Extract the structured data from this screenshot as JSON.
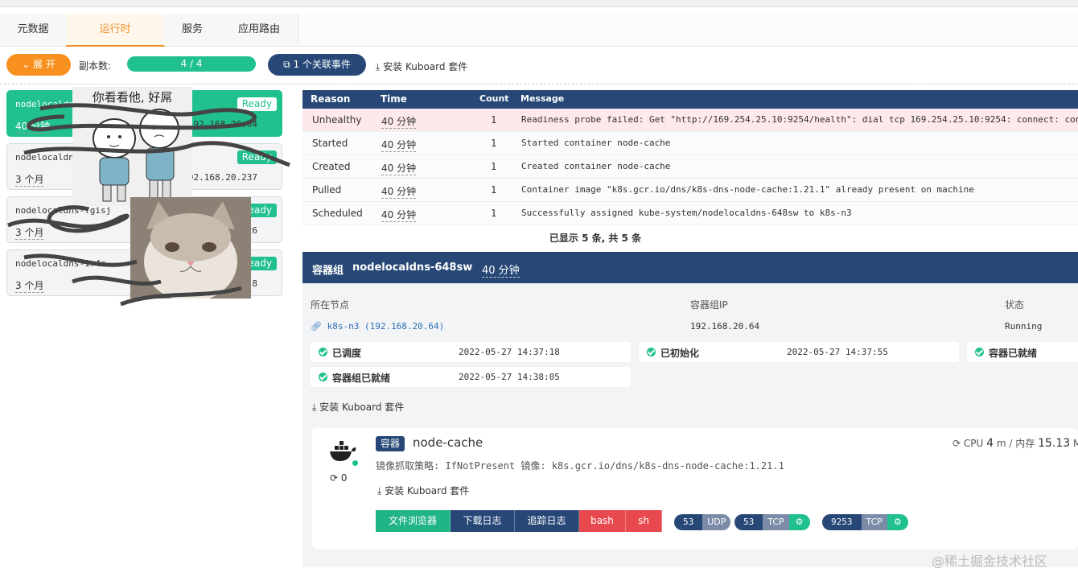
{
  "tabs": [
    "元数据",
    "运行时",
    "服务",
    "应用路由"
  ],
  "active_tab": "运行时",
  "toolbar": {
    "expand_label": "展 开",
    "replica_label": "副本数:",
    "replica_value": "4 / 4",
    "events_label": "1 个关联事件",
    "install_label": "安装 Kuboard 套件"
  },
  "pods": [
    {
      "name": "nodelocaldns-",
      "age": "40 分钟",
      "ip": "192.168.20.64",
      "status": "Ready",
      "active": true
    },
    {
      "name": "nodelocaldns-",
      "age": "3 个月",
      "ip": "192.168.20.237",
      "status": "Ready",
      "active": false
    },
    {
      "name": "nodelocaldns-fgisj",
      "age": "3 个月",
      "ip": "192.168.20.26",
      "status": "Ready",
      "active": false
    },
    {
      "name": "nodelocaldns-1r4c",
      "age": "3 个月",
      "ip": "192.168.20.8",
      "status": "Ready",
      "active": false
    }
  ],
  "events": {
    "headers": [
      "Reason",
      "Time",
      "Count",
      "Message"
    ],
    "rows": [
      {
        "reason": "Unhealthy",
        "time": "40 分钟",
        "count": "1",
        "message": "Readiness probe failed: Get \"http://169.254.25.10:9254/health\": dial tcp 169.254.25.10:9254: connect: con",
        "warn": true
      },
      {
        "reason": "Started",
        "time": "40 分钟",
        "count": "1",
        "message": "Started container node-cache",
        "warn": false
      },
      {
        "reason": "Created",
        "time": "40 分钟",
        "count": "1",
        "message": "Created container node-cache",
        "warn": false
      },
      {
        "reason": "Pulled",
        "time": "40 分钟",
        "count": "1",
        "message": "Container image \"k8s.gcr.io/dns/k8s-dns-node-cache:1.21.1\" already present on machine",
        "warn": false
      },
      {
        "reason": "Scheduled",
        "time": "40 分钟",
        "count": "1",
        "message": "Successfully assigned kube-system/nodelocaldns-648sw to k8s-n3",
        "warn": false
      }
    ],
    "summary": "已显示 5 条, 共 5 条"
  },
  "pod_panel": {
    "label": "容器组",
    "name": "nodelocaldns-648sw",
    "age": "40 分钟",
    "node_label": "所在节点",
    "node_value": "k8s-n3  (192.168.20.64)",
    "ip_label": "容器组IP",
    "ip_value": "192.168.20.64",
    "status_label": "状态",
    "status_value": "Running",
    "conditions": [
      {
        "name": "已调度",
        "time": "2022-05-27 14:37:18"
      },
      {
        "name": "已初始化",
        "time": "2022-05-27 14:37:55"
      },
      {
        "name": "容器已就绪",
        "time": ""
      },
      {
        "name": "容器组已就绪",
        "time": "2022-05-27 14:38:05"
      }
    ],
    "install_label": "安装 Kuboard 套件"
  },
  "container": {
    "badge": "容器",
    "name": "node-cache",
    "restarts": "0",
    "policy": "镜像抓取策略: IfNotPresent   镜像: k8s.gcr.io/dns/k8s-dns-node-cache:1.21.1",
    "cpu_label": "CPU",
    "cpu_value": "4",
    "cpu_unit": "m / 内存",
    "mem_value": "15.13",
    "mem_unit": "M",
    "install_label": "安装 Kuboard 套件",
    "actions": [
      {
        "label": "文件浏览器",
        "color": "#20b487"
      },
      {
        "label": "下载日志",
        "color": "#274877"
      },
      {
        "label": "追踪日志",
        "color": "#274877"
      },
      {
        "label": "bash",
        "color": "#e8494f"
      },
      {
        "label": "sh",
        "color": "#e8494f"
      }
    ],
    "ports": [
      {
        "port": "53",
        "proto": "UDP"
      },
      {
        "port": "53",
        "proto": "TCP"
      },
      {
        "port": "9253",
        "proto": "TCP"
      }
    ]
  },
  "overlay": {
    "meme_caption": "你看看他, 好屌"
  },
  "watermark": "@稀土掘金技术社区"
}
